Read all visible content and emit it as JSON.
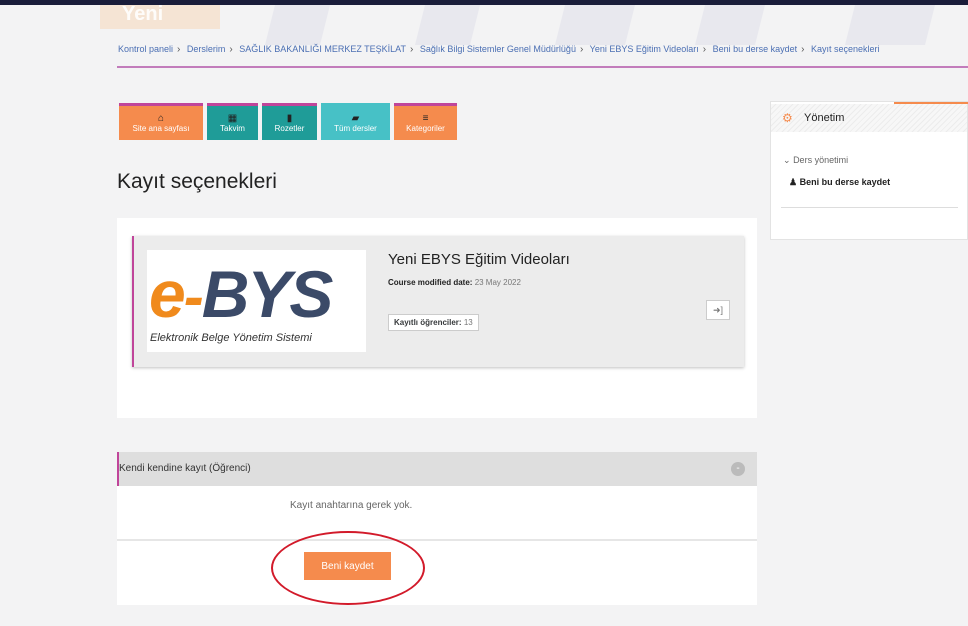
{
  "header": {
    "hero_text": "Yeni"
  },
  "breadcrumb": [
    "Kontrol paneli",
    "Derslerim",
    "SAĞLIK BAKANLIĞI MERKEZ TEŞKİLAT",
    "Sağlık Bilgi Sistemler Genel Müdürlüğü",
    "Yeni EBYS Eğitim Videoları",
    "Beni bu derse kaydet",
    "Kayıt seçenekleri"
  ],
  "quicklinks": [
    {
      "label": "Site ana sayfası",
      "icon": "home-icon",
      "color": "#f58b4d"
    },
    {
      "label": "Takvim",
      "icon": "calendar-icon",
      "color": "#1f9c98"
    },
    {
      "label": "Rozetler",
      "icon": "bookmark-icon",
      "color": "#1f9c98"
    },
    {
      "label": "Tüm dersler",
      "icon": "book-icon",
      "color": "#47c1c6"
    },
    {
      "label": "Kategoriler",
      "icon": "list-icon",
      "color": "#f58b4d"
    }
  ],
  "page": {
    "title": "Kayıt seçenekleri"
  },
  "course": {
    "logo_e": "e",
    "logo_dash": "-",
    "logo_bys": "BYS",
    "logo_subtitle": "Elektronik Belge Yönetim Sistemi",
    "name": "Yeni EBYS Eğitim Videoları",
    "modified_label": "Course modified date:",
    "modified_value": "23 May 2022",
    "students_label": "Kayıtlı öğrenciler:",
    "students_value": "13"
  },
  "enrol": {
    "section_title": "Kendi kendine kayıt (Öğrenci)",
    "collapse_symbol": "-",
    "no_key_text": "Kayıt anahtarına gerek yok.",
    "button_label": "Beni kaydet"
  },
  "admin": {
    "title": "Yönetim",
    "group": "Ders yönetimi",
    "item": "Beni bu derse kaydet"
  },
  "colors": {
    "accent_orange": "#f58b4d",
    "accent_teal": "#1f9c98",
    "accent_magenta": "#c0459a",
    "annotation_red": "#d21a2a"
  }
}
